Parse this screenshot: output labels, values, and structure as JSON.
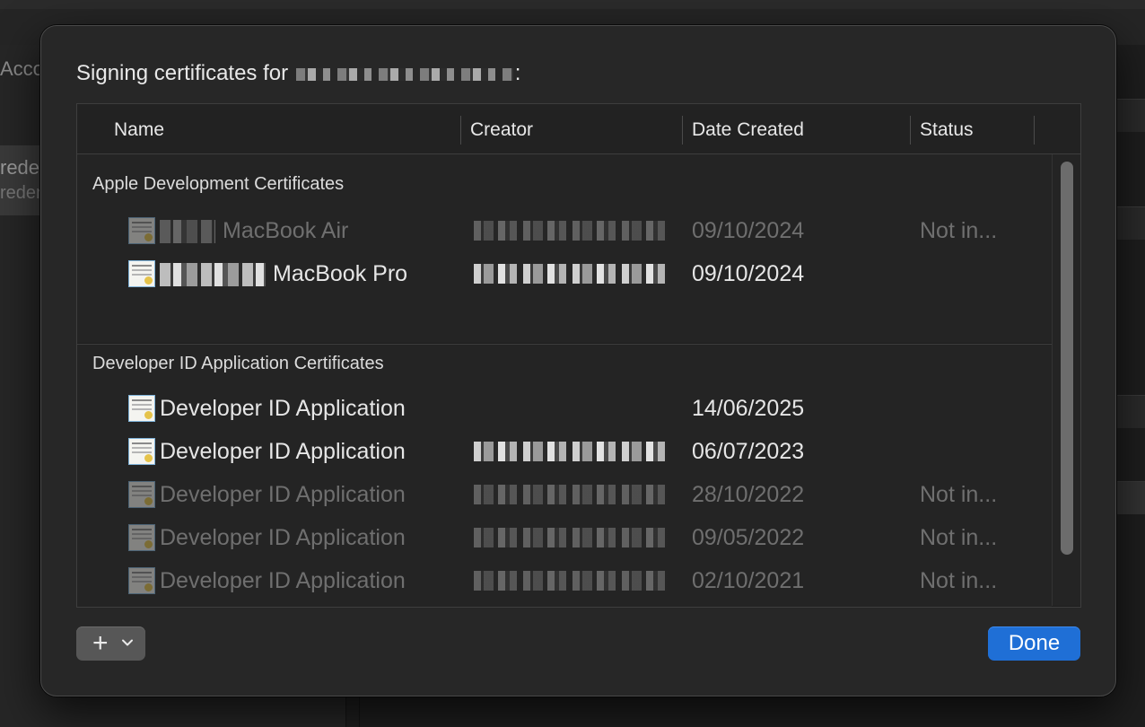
{
  "background": {
    "sidebar_label_1": "Accou",
    "sidebar_label_2": "rede",
    "sidebar_label_3": "reden"
  },
  "sheet": {
    "title_prefix": "Signing certificates for",
    "title_suffix": ":"
  },
  "table": {
    "columns": [
      "Name",
      "Creator",
      "Date Created",
      "Status"
    ],
    "sections": [
      {
        "title": "Apple Development Certificates",
        "rows": [
          {
            "name": "MacBook Air",
            "date": "09/10/2024",
            "status": "Not in..."
          },
          {
            "name": "MacBook Pro",
            "date": "09/10/2024",
            "status": ""
          }
        ]
      },
      {
        "title": "Developer ID Application Certificates",
        "rows": [
          {
            "name": "Developer ID Application",
            "date": "14/06/2025",
            "status": ""
          },
          {
            "name": "Developer ID Application",
            "date": "06/07/2023",
            "status": ""
          },
          {
            "name": "Developer ID Application",
            "date": "28/10/2022",
            "status": "Not in..."
          },
          {
            "name": "Developer ID Application",
            "date": "09/05/2022",
            "status": "Not in..."
          },
          {
            "name": "Developer ID Application",
            "date": "02/10/2021",
            "status": "Not in..."
          }
        ]
      }
    ]
  },
  "buttons": {
    "add_label": "+",
    "done_label": "Done"
  },
  "icons": {
    "cert": "certificate-icon",
    "add": "plus-icon",
    "menu": "chevron-down-icon"
  },
  "colors": {
    "accent": "#1f6fd6",
    "sheet_bg": "#272727",
    "table_bg": "#1d1d1d"
  }
}
